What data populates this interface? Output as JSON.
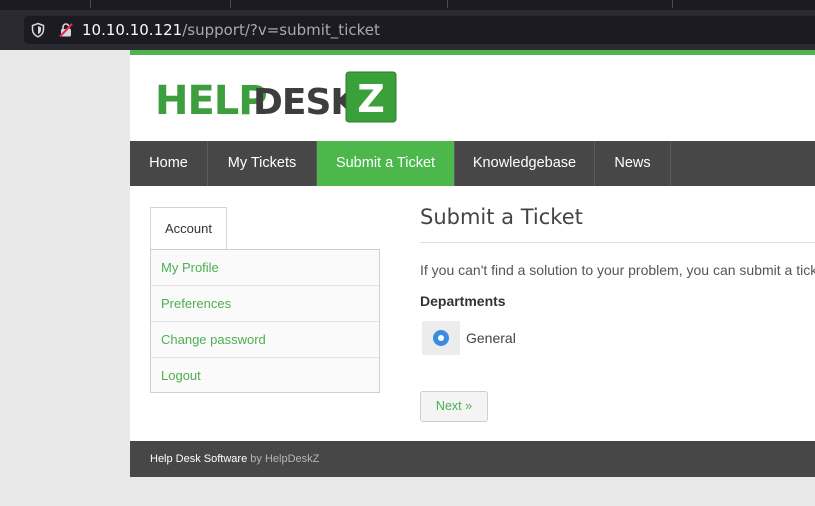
{
  "browser": {
    "url_host": "10.10.10.121",
    "url_path": "/support/?v=submit_ticket"
  },
  "site": {
    "logo": {
      "part1": "HELP",
      "part2": "DESK",
      "part3": "Z",
      "green": "#3d9e3d",
      "dark": "#3d3d3d"
    },
    "accent_color": "#4cb84c",
    "nav": [
      {
        "label": "Home"
      },
      {
        "label": "My Tickets"
      },
      {
        "label": "Submit a Ticket",
        "active": true
      },
      {
        "label": "Knowledgebase"
      },
      {
        "label": "News"
      }
    ]
  },
  "sidebar": {
    "tab_label": "Account",
    "items": [
      {
        "label": "My Profile"
      },
      {
        "label": "Preferences"
      },
      {
        "label": "Change password"
      },
      {
        "label": "Logout"
      }
    ]
  },
  "main": {
    "title": "Submit a Ticket",
    "intro": "If you can't find a solution to your problem, you can submit a ticket by selecting the appropriate department below.",
    "departments_label": "Departments",
    "department_option": "General",
    "next_label": "Next »"
  },
  "footer": {
    "software": "Help Desk Software",
    "by_text": "by HelpDeskZ"
  }
}
